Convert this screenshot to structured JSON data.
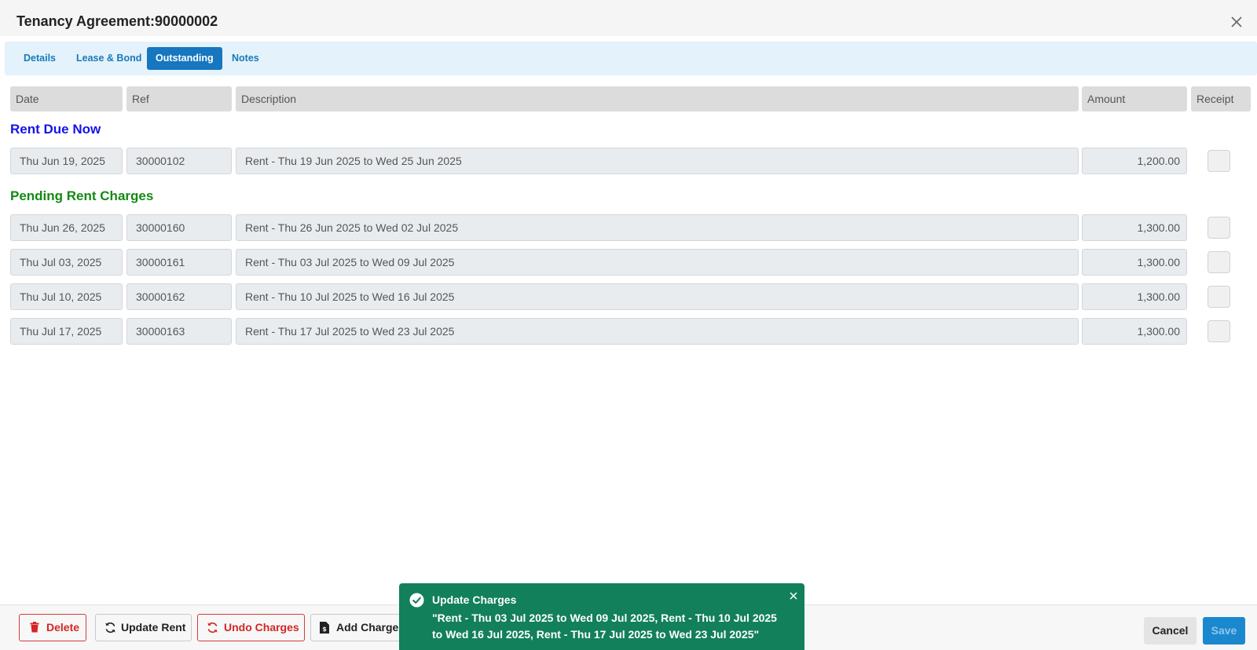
{
  "window": {
    "title": "Tenancy Agreement:90000002"
  },
  "tabs": [
    {
      "label": "Details",
      "active": false
    },
    {
      "label": "Lease & Bond",
      "active": false
    },
    {
      "label": "Outstanding",
      "active": true
    },
    {
      "label": "Notes",
      "active": false
    }
  ],
  "table": {
    "columns": {
      "date": "Date",
      "ref": "Ref",
      "description": "Description",
      "amount": "Amount",
      "receipt": "Receipt"
    }
  },
  "sections": {
    "rent_due_now": {
      "title": "Rent Due Now",
      "color": "#1414e6",
      "rows": [
        {
          "date": "Thu Jun 19, 2025",
          "ref": "30000102",
          "description": "Rent - Thu 19 Jun 2025 to Wed 25 Jun 2025",
          "amount": "1,200.00",
          "receipt": false
        }
      ]
    },
    "pending_rent_charges": {
      "title": "Pending Rent Charges",
      "color": "#138a13",
      "rows": [
        {
          "date": "Thu Jun 26, 2025",
          "ref": "30000160",
          "description": "Rent - Thu 26 Jun 2025 to Wed 02 Jul 2025",
          "amount": "1,300.00",
          "receipt": false
        },
        {
          "date": "Thu Jul 03, 2025",
          "ref": "30000161",
          "description": "Rent - Thu 03 Jul 2025 to Wed 09 Jul 2025",
          "amount": "1,300.00",
          "receipt": false
        },
        {
          "date": "Thu Jul 10, 2025",
          "ref": "30000162",
          "description": "Rent - Thu 10 Jul 2025 to Wed 16 Jul 2025",
          "amount": "1,300.00",
          "receipt": false
        },
        {
          "date": "Thu Jul 17, 2025",
          "ref": "30000163",
          "description": "Rent - Thu 17 Jul 2025 to Wed 23 Jul 2025",
          "amount": "1,300.00",
          "receipt": false
        }
      ]
    }
  },
  "footer": {
    "delete_label": "Delete",
    "update_rent_label": "Update Rent",
    "undo_charges_label": "Undo Charges",
    "add_charge_label": "Add Charge",
    "cancel_label": "Cancel",
    "save_label": "Save"
  },
  "toast": {
    "title": "Update Charges",
    "message": "\"Rent - Thu 03 Jul 2025 to Wed 09 Jul 2025, Rent - Thu 10 Jul 2025 to Wed 16 Jul 2025, Rent - Thu 17 Jul 2025 to Wed 23 Jul 2025\"",
    "color": "#12805a"
  },
  "icons": {
    "close": "close-icon",
    "delete": "trash-icon",
    "update_rent": "refresh-icon",
    "undo_charges": "refresh-icon",
    "add_charge": "document-dollar-icon",
    "toast_status": "check-circle-icon",
    "toast_close": "close-icon"
  }
}
